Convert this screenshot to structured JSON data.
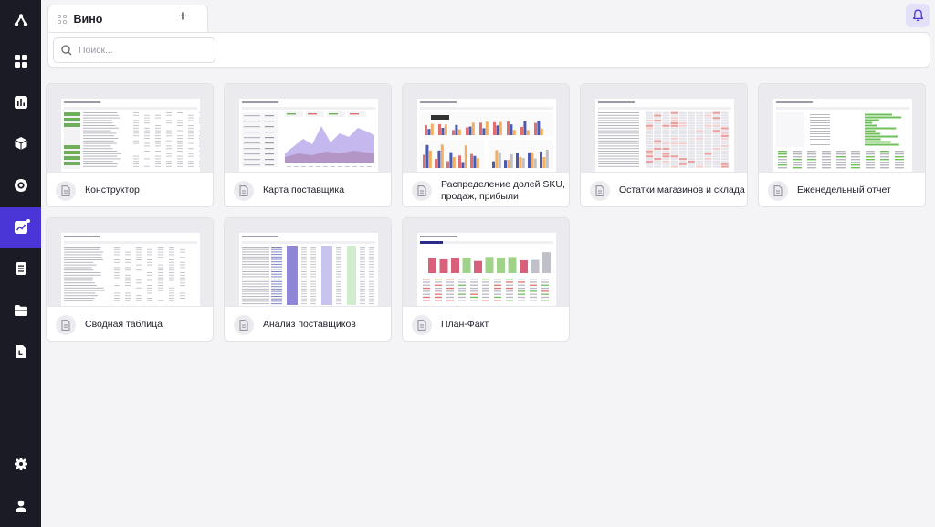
{
  "sidebar": {
    "items": [
      {
        "icon": "logo-icon"
      },
      {
        "icon": "dashboard-icon"
      },
      {
        "icon": "bar-chart-icon"
      },
      {
        "icon": "cube-icon"
      },
      {
        "icon": "target-icon"
      },
      {
        "icon": "trend-chart-icon",
        "active": true
      },
      {
        "icon": "list-icon"
      },
      {
        "icon": "folder-icon"
      },
      {
        "icon": "document-icon"
      }
    ],
    "bottom": [
      {
        "icon": "gear-icon"
      },
      {
        "icon": "user-icon"
      }
    ],
    "active_color": "#4a35d6"
  },
  "tab": {
    "label": "Вино",
    "add_label": "+"
  },
  "search": {
    "placeholder": "Поиск..."
  },
  "reports": [
    {
      "title": "Конструктор",
      "thumb": "table"
    },
    {
      "title": "Карта поставщика",
      "thumb": "area"
    },
    {
      "title": "Распределение долей SKU, продаж, прибыли",
      "thumb": "bars"
    },
    {
      "title": "Остатки магазинов и склада",
      "thumb": "heat"
    },
    {
      "title": "Еженедельный отчет",
      "thumb": "hbar"
    },
    {
      "title": "Сводная таблица",
      "thumb": "table"
    },
    {
      "title": "Анализ поставщиков",
      "thumb": "colstripes"
    },
    {
      "title": "План-Факт",
      "thumb": "planfact"
    }
  ],
  "colors": {
    "accent": "#4a35d6",
    "sidebar_bg": "#1b1b25",
    "bell_bg": "#e3e0fa"
  }
}
